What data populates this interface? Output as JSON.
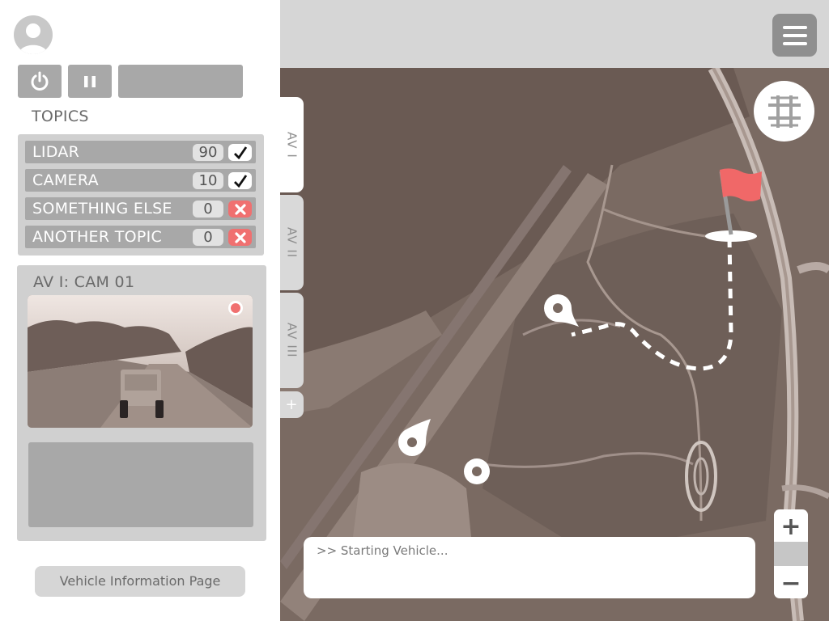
{
  "topics": {
    "title": "TOPICS",
    "items": [
      {
        "name": "LIDAR",
        "count": "90",
        "enabled": true
      },
      {
        "name": "CAMERA",
        "count": "10",
        "enabled": true
      },
      {
        "name": "SOMETHING ELSE",
        "count": "0",
        "enabled": false
      },
      {
        "name": "ANOTHER TOPIC",
        "count": "0",
        "enabled": false
      }
    ]
  },
  "camera": {
    "title": "AV I: CAM 01",
    "recording": true
  },
  "vehicle_info_button": "Vehicle Information Page",
  "av_tabs": [
    {
      "label": "AV I",
      "active": true
    },
    {
      "label": "AV II",
      "active": false
    },
    {
      "label": "AV III",
      "active": false
    }
  ],
  "add_tab_label": "+",
  "console": {
    "text": ">> Starting Vehicle..."
  },
  "zoom": {
    "in_label": "+",
    "out_label": "−"
  },
  "colors": {
    "accent_red": "#f07070",
    "panel_gray": "#d0d0d0",
    "button_gray": "#a8a8a8",
    "topbar_gray": "#d6d6d6"
  },
  "icons": [
    "user-icon",
    "power-icon",
    "pause-icon",
    "check-icon",
    "x-icon",
    "hamburger-menu-icon",
    "grid-icon",
    "flag-icon",
    "location-pin-icon",
    "waypoint-icon"
  ]
}
